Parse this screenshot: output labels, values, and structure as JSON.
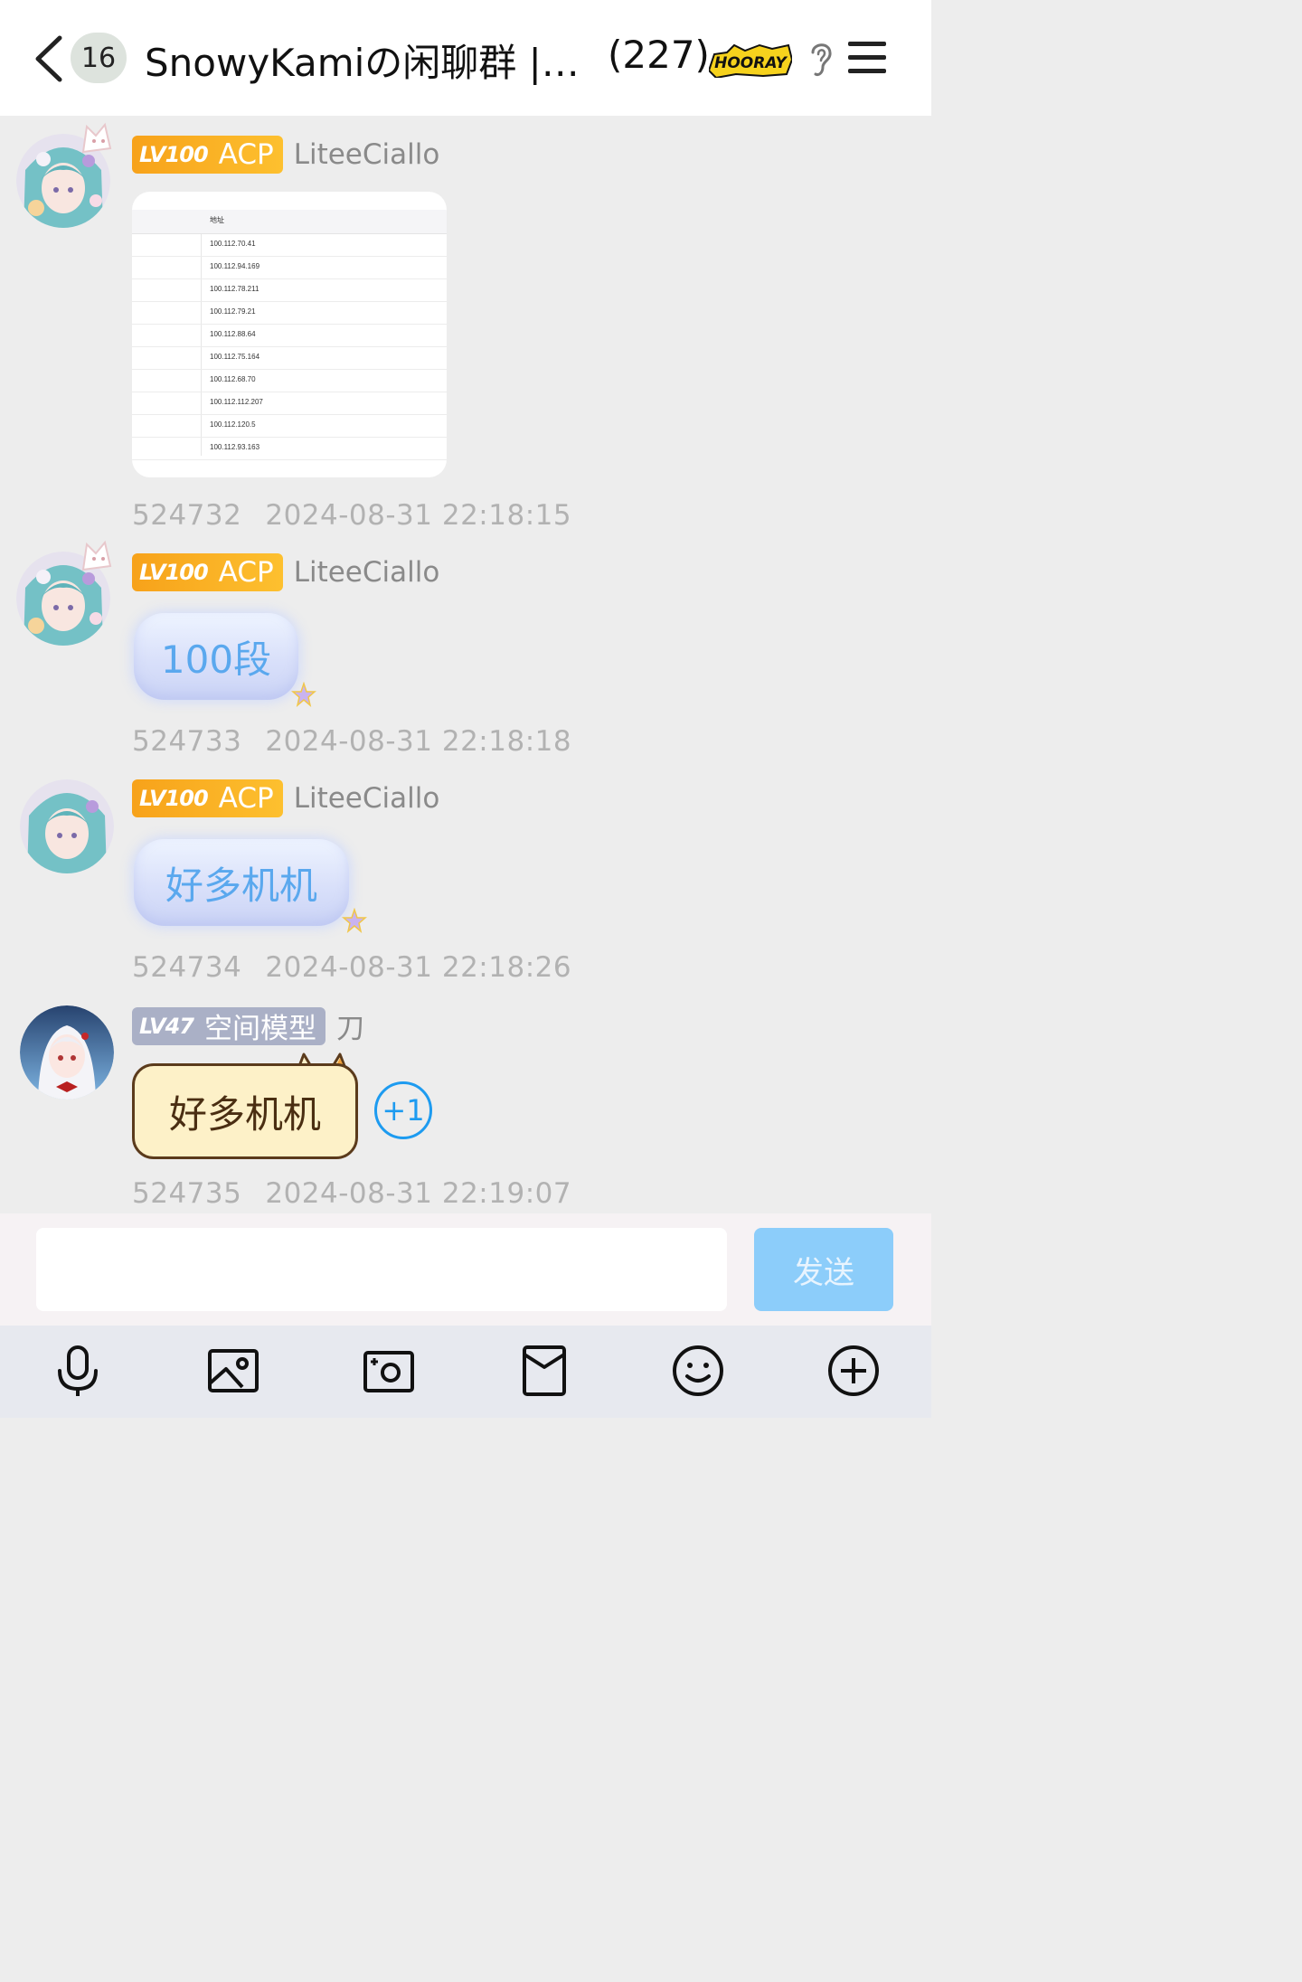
{
  "header": {
    "unread_count": "16",
    "title": "SnowyKamiの闲聊群 |…",
    "member_count": "(227)",
    "sticker_text": "HOORAY"
  },
  "messages": [
    {
      "level": "LV100",
      "title_badge": "ACP",
      "nickname": "LiteeCiallo",
      "type": "image",
      "image_table": {
        "header": "地址",
        "rows": [
          "100.112.70.41",
          "100.112.94.169",
          "100.112.78.211",
          "100.112.79.21",
          "100.112.88.64",
          "100.112.75.164",
          "100.112.68.70",
          "100.112.112.207",
          "100.112.120.5",
          "100.112.93.163"
        ]
      },
      "msg_id": "524732",
      "time": "2024-08-31 22:18:15"
    },
    {
      "level": "LV100",
      "title_badge": "ACP",
      "nickname": "LiteeCiallo",
      "text": "100段",
      "msg_id": "524733",
      "time": "2024-08-31 22:18:18"
    },
    {
      "level": "LV100",
      "title_badge": "ACP",
      "nickname": "LiteeCiallo",
      "text": "好多机机",
      "msg_id": "524734",
      "time": "2024-08-31 22:18:26"
    },
    {
      "level": "LV47",
      "title_badge": "空间模型",
      "nickname": "刀",
      "text": "好多机机",
      "plus_one": "+1",
      "msg_id": "524735",
      "time": "2024-08-31 22:19:07"
    }
  ],
  "input": {
    "value": "",
    "send_label": "发送"
  },
  "toolbar": [
    "microphone-icon",
    "image-icon",
    "camera-icon",
    "red-packet-icon",
    "emoji-icon",
    "plus-icon"
  ],
  "colors": {
    "accent": "#1d9bf0",
    "send_button": "#8ccdfa",
    "badge_gold": "#f7a21a",
    "badge_gray": "#aab0c6"
  }
}
